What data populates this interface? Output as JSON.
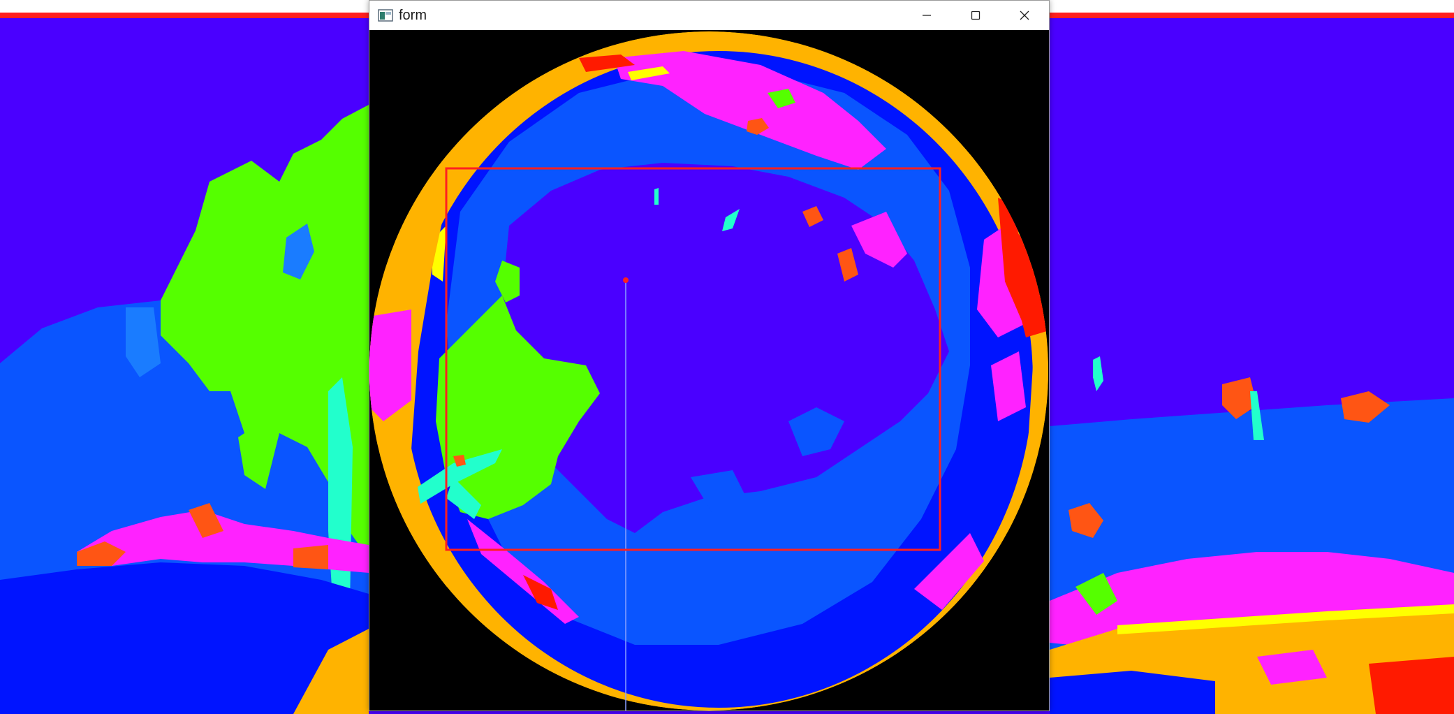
{
  "window": {
    "title": "form",
    "controls": {
      "minimize": "minimize-icon",
      "maximize": "maximize-icon",
      "close": "close-icon"
    }
  },
  "colors": {
    "purple": "#4a00ff",
    "blue": "#0014ff",
    "mid_blue": "#0a55ff",
    "light_blue": "#1a7cff",
    "green": "#55ff00",
    "magenta": "#ff22ff",
    "orange": "#ffb300",
    "red": "#ff1a00",
    "orange_red": "#ff5514",
    "cyan": "#22ffcc",
    "yellow": "#ffff00",
    "selection_border": "#ff2020"
  }
}
